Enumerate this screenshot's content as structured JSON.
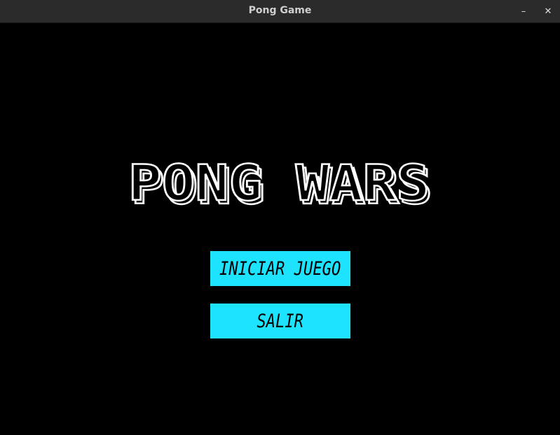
{
  "window": {
    "title": "Pong Game",
    "minimize_icon": "minimize-icon",
    "close_icon": "close-icon",
    "minimize_glyph": "–",
    "close_glyph": "✕"
  },
  "game": {
    "logo_text": "PONG WARS",
    "background_color": "#000000",
    "logo_color": "#ffffff",
    "menu": {
      "start_label": "INICIAR JUEGO",
      "exit_label": "SALIR",
      "button_color": "#1de3ff",
      "button_text_color": "#000000"
    }
  }
}
